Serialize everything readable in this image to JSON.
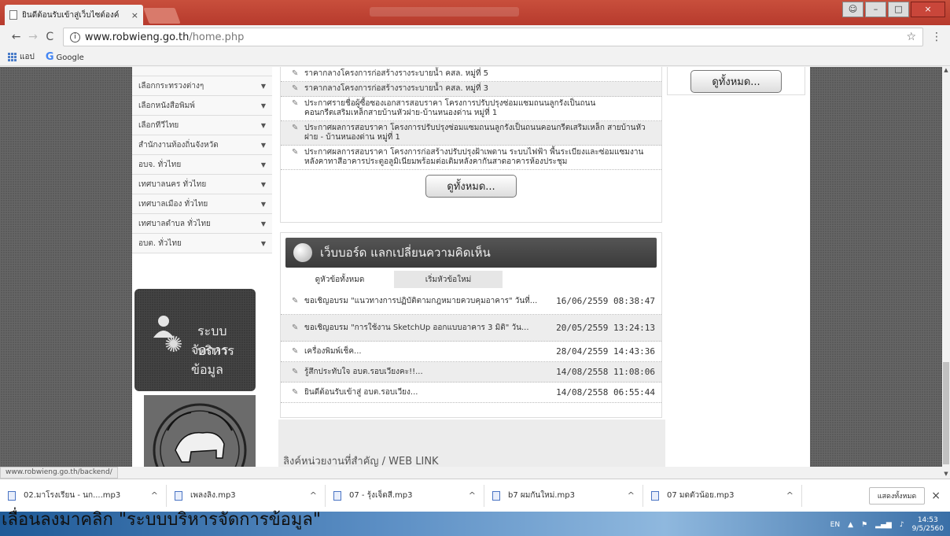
{
  "browser": {
    "tab_title": "ยินดีต้อนรับเข้าสู่เว็บไซต์องค์",
    "tab_close": "×",
    "url_host": "www.robwieng.go.th",
    "url_path": "/home.php",
    "bookmarks": [
      "แอป",
      "Google"
    ],
    "status_url": "www.robwieng.go.th/backend/"
  },
  "side_menu": [
    "เลือกกระทรวงต่างๆ",
    "เลือกหนังสือพิมพ์",
    "เลือกทีวีไทย",
    "สำนักงานท้องถิ่นจังหวัด",
    "อบจ. ทั่วไทย",
    "เทศบาลนคร ทั่วไทย",
    "เทศบาลเมือง ทั่วไทย",
    "เทศบาลตำบล ทั่วไทย",
    "อบต. ทั่วไทย"
  ],
  "admin_panel": {
    "line1": "ระบบบริหาร",
    "line2": "จัดการข้อมูล"
  },
  "news": [
    "ราคากลางโครงการก่อสร้างรางระบายน้ำ คสล. หมู่ที่ 5",
    "ราคากลางโครงการก่อสร้างรางระบายน้ำ คสล. หมู่ที่ 3",
    "ประกาศรายชื่อผู้ซื้อซองเอกสารสอบราคา โครงการปรับปรุงซ่อมแซมถนนลูกรังเป็นถนนคอนกรีตเสริมเหล็กสายบ้านหัวฝาย-บ้านหนองด่าน หมู่ที่ 1",
    "ประกาศผลการสอบราคา โครงการปรับปรุงซ่อมแซมถนนลูกรังเป็นถนนคอนกรีตเสริมเหล็ก สายบ้านหัวฝาย - บ้านหนองด่าน หมู่ที่ 1",
    "ประกาศผลการสอบราคา โครงการก่อสร้างปรับปรุงฝ้าเพดาน ระบบไฟฟ้า พื้นระเบียงและซ่อมแซมงานหลังคาทาสีอาคารประตูอลูมิเนียมพร้อมต่อเติมหลังคากันสาดอาคารห้องประชุม"
  ],
  "view_all": "ดูทั้งหมด...",
  "webboard": {
    "title": "เว็บบอร์ด แลกเปลี่ยนความคิดเห็น",
    "tab_all": "ดูหัวข้อทั้งหมด",
    "tab_new": "เริ่มหัวข้อใหม่",
    "rows": [
      {
        "subject": "ขอเชิญอบรม \"แนวทางการปฏิบัติตามกฎหมายควบคุมอาคาร\" วันที่...",
        "date": "16/06/2559 08:38:47"
      },
      {
        "subject": "ขอเชิญอบรม \"การใช้งาน SketchUp ออกแบบอาคาร 3 มิติ\" วัน...",
        "date": "20/05/2559 13:24:13"
      },
      {
        "subject": "เครื่องพิมพ์เช็ค...",
        "date": "28/04/2559 14:43:36"
      },
      {
        "subject": "รู้สึกประทับใจ อบต.รอบเวียงคะ!!...",
        "date": "14/08/2558 11:08:06"
      },
      {
        "subject": "ยินดีต้อนรับเข้าสู่ อบต.รอบเวียง...",
        "date": "14/08/2558 06:55:44"
      }
    ]
  },
  "weblink_title": "ลิงค์หน่วยงานที่สำคัญ / WEB LINK",
  "downloads": [
    "02.มาโรงเรียน - นก....mp3",
    "เพลงลิง.mp3",
    "07 - รุ้งเจ็ดสี.mp3",
    "b7 ผมกันใหม่.mp3",
    "07 มดตัวน้อย.mp3"
  ],
  "downloads_show_all": "แสดงทั้งหมด",
  "caption": "เลื่อนลงมาคลิก \"ระบบบริหารจัดการข้อมูล\"",
  "tray": {
    "lang": "EN",
    "time": "14:53",
    "date": "9/5/2560"
  }
}
